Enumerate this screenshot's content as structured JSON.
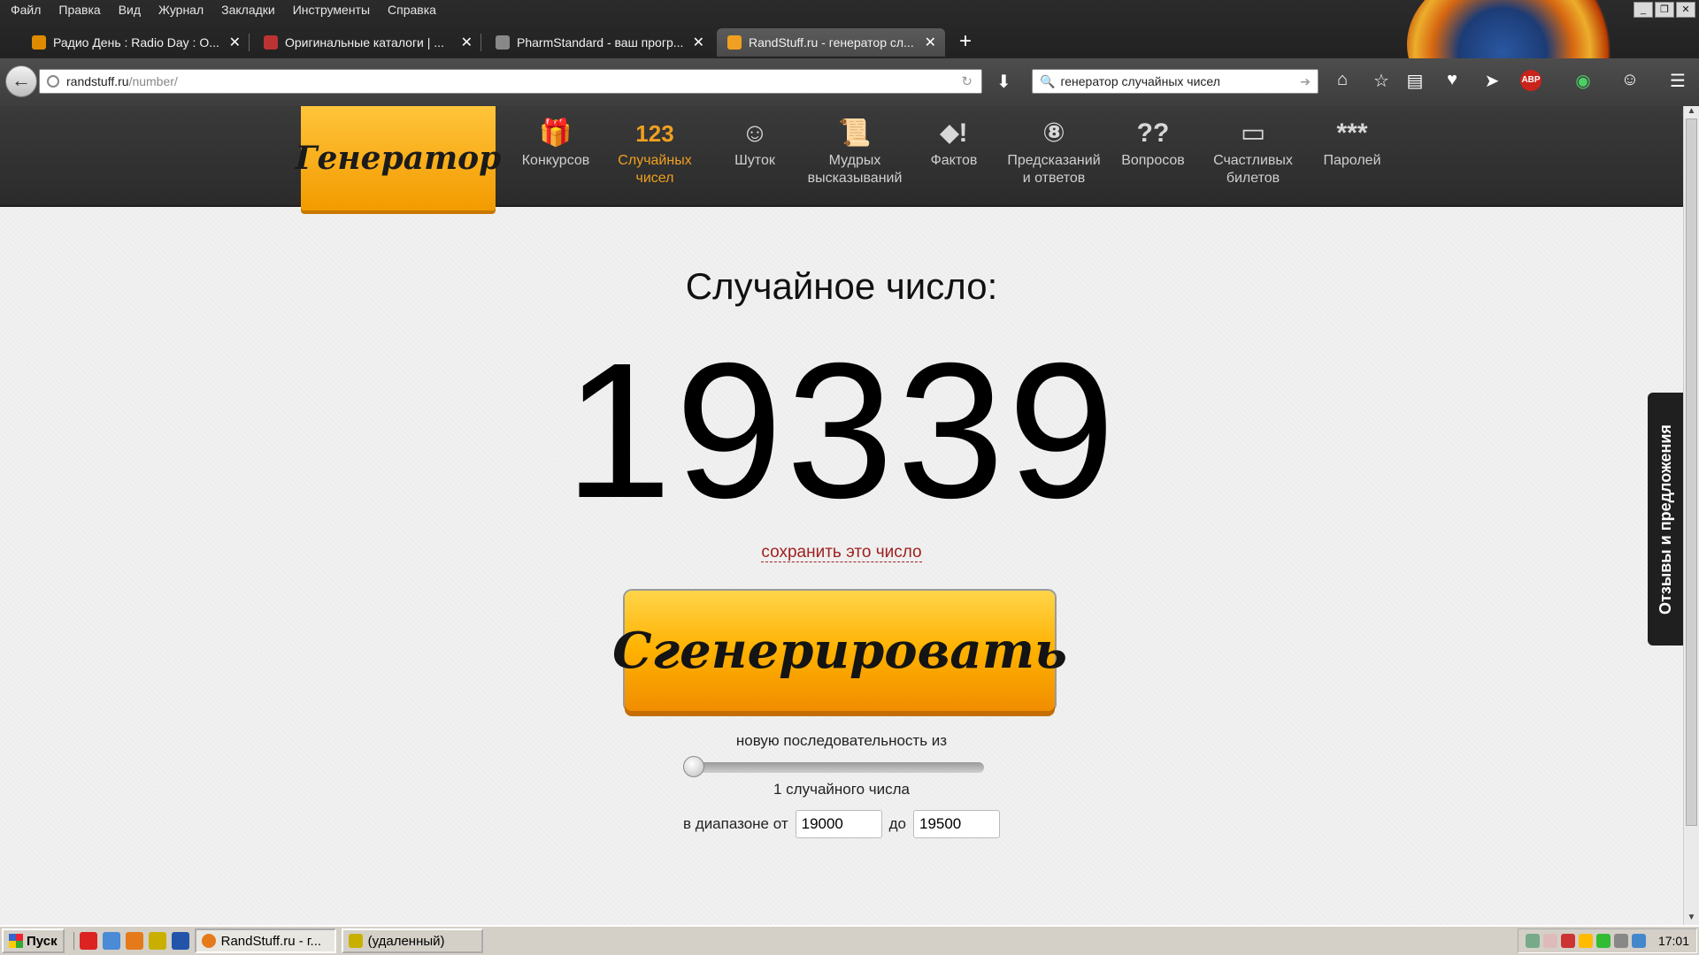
{
  "browser": {
    "menu": [
      "Файл",
      "Правка",
      "Вид",
      "Журнал",
      "Закладки",
      "Инструменты",
      "Справка"
    ],
    "window_controls": [
      "_",
      "❐",
      "✕"
    ],
    "tabs": [
      {
        "title": "Радио День : Radio Day : О...",
        "close": "✕",
        "favicon_color": "#e08a00"
      },
      {
        "title": "Оригинальные каталоги | ...",
        "close": "✕",
        "favicon_color": "#b33"
      },
      {
        "title": "PharmStandard - ваш прогр...",
        "close": "✕",
        "favicon_color": "#888"
      },
      {
        "title": "RandStuff.ru - генератор сл...",
        "close": "✕",
        "favicon_color": "#f0a020"
      }
    ],
    "new_tab": "+",
    "url_host": "randstuff.ru",
    "url_path": "/number/",
    "search_value": "генератор случайных чисел",
    "back_icon": "←",
    "reload_icon": "↻",
    "icons": [
      "download-icon",
      "home-icon",
      "bookmark-star-icon",
      "reading-list-icon",
      "pocket-icon",
      "send-icon",
      "adblock-icon",
      "grammarly-icon",
      "smiley-icon",
      "menu-icon"
    ],
    "adblock_label": "ABP"
  },
  "site": {
    "brand": "Генератор",
    "nav": [
      {
        "icon": "🎁",
        "label": "Конкурсов"
      },
      {
        "icon": "123",
        "label": "Случайных чисел",
        "active": true
      },
      {
        "icon": "☺",
        "label": "Шуток"
      },
      {
        "icon": "📜",
        "label": "Мудрых высказываний"
      },
      {
        "icon": "⬥!",
        "label": "Фактов"
      },
      {
        "icon": "⑧",
        "label": "Предсказаний и ответов"
      },
      {
        "icon": "??",
        "label": "Вопросов"
      },
      {
        "icon": "▭",
        "label": "Счастливых билетов"
      },
      {
        "icon": "***",
        "label": "Паролей"
      }
    ],
    "result_title": "Случайное число:",
    "result_value": "19339",
    "save_link": "сохранить это число",
    "generate_button": "Сгенерировать",
    "sequence_label": "новую последовательность из",
    "sequence_count": 1,
    "count_label": "1 случайного числа",
    "range_prefix": "в диапазоне от",
    "range_middle": "до",
    "range_from": "19000",
    "range_to": "19500",
    "feedback": "Отзывы и предложения"
  },
  "taskbar": {
    "start": "Пуск",
    "tasks": [
      {
        "label": "RandStuff.ru - г...",
        "pressed": true
      },
      {
        "label": "(удаленный)",
        "pressed": false
      }
    ],
    "clock": "17:01"
  }
}
